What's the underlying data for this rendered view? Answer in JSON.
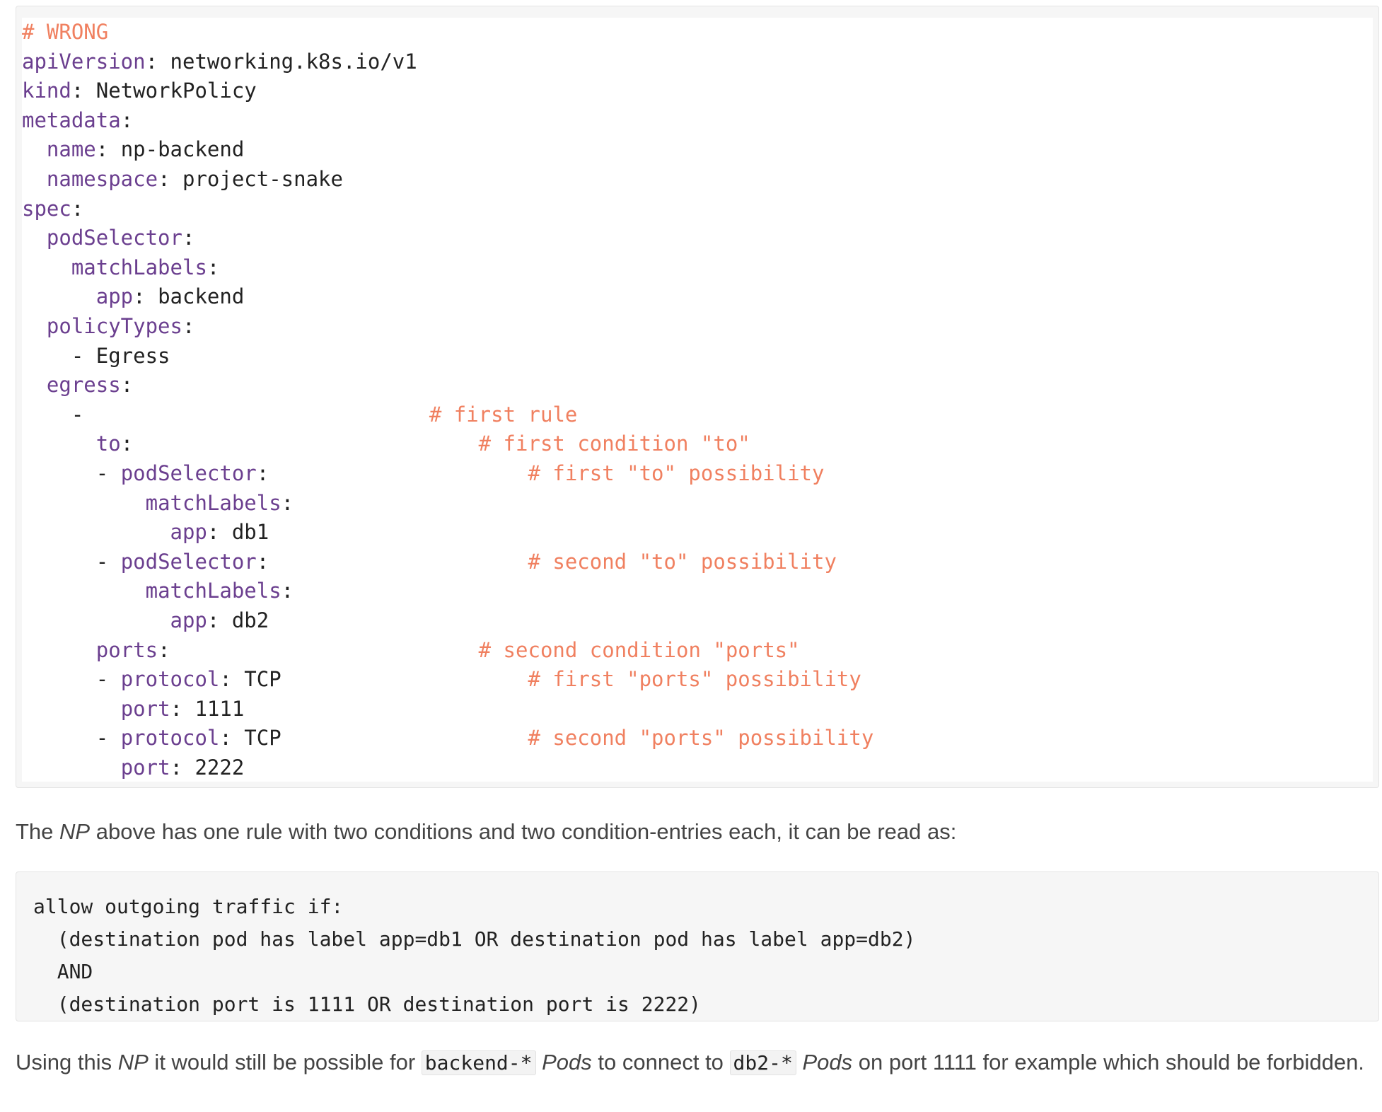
{
  "yaml_block": {
    "lines": [
      {
        "indent": "",
        "key": "",
        "value": "",
        "comment": "# WRONG",
        "comment_col": 0
      },
      {
        "indent": "",
        "key": "apiVersion",
        "value": "networking.k8s.io/v1",
        "comment": ""
      },
      {
        "indent": "",
        "key": "kind",
        "value": "NetworkPolicy",
        "comment": ""
      },
      {
        "indent": "",
        "key": "metadata",
        "value": "",
        "comment": ""
      },
      {
        "indent": "  ",
        "key": "name",
        "value": "np-backend",
        "comment": ""
      },
      {
        "indent": "  ",
        "key": "namespace",
        "value": "project-snake",
        "comment": ""
      },
      {
        "indent": "",
        "key": "spec",
        "value": "",
        "comment": ""
      },
      {
        "indent": "  ",
        "key": "podSelector",
        "value": "",
        "comment": ""
      },
      {
        "indent": "    ",
        "key": "matchLabels",
        "value": "",
        "comment": ""
      },
      {
        "indent": "      ",
        "key": "app",
        "value": "backend",
        "comment": ""
      },
      {
        "indent": "  ",
        "key": "policyTypes",
        "value": "",
        "comment": ""
      },
      {
        "indent": "    ",
        "key": "",
        "value": "- Egress",
        "comment": ""
      },
      {
        "indent": "  ",
        "key": "egress",
        "value": "",
        "comment": ""
      },
      {
        "indent": "    ",
        "key": "",
        "value": "-",
        "comment": "# first rule",
        "comment_col": 33
      },
      {
        "indent": "      ",
        "key": "to",
        "value": "",
        "comment": "# first condition \"to\"",
        "comment_col": 37
      },
      {
        "indent": "      - ",
        "key": "podSelector",
        "value": "",
        "comment": "# first \"to\" possibility",
        "comment_col": 41
      },
      {
        "indent": "          ",
        "key": "matchLabels",
        "value": "",
        "comment": ""
      },
      {
        "indent": "            ",
        "key": "app",
        "value": "db1",
        "comment": ""
      },
      {
        "indent": "      - ",
        "key": "podSelector",
        "value": "",
        "comment": "# second \"to\" possibility",
        "comment_col": 41
      },
      {
        "indent": "          ",
        "key": "matchLabels",
        "value": "",
        "comment": ""
      },
      {
        "indent": "            ",
        "key": "app",
        "value": "db2",
        "comment": ""
      },
      {
        "indent": "      ",
        "key": "ports",
        "value": "",
        "comment": "# second condition \"ports\"",
        "comment_col": 37
      },
      {
        "indent": "      - ",
        "key": "protocol",
        "value": "TCP",
        "comment": "# first \"ports\" possibility",
        "comment_col": 41
      },
      {
        "indent": "        ",
        "key": "port",
        "value": "1111",
        "comment": ""
      },
      {
        "indent": "      - ",
        "key": "protocol",
        "value": "TCP",
        "comment": "# second \"ports\" possibility",
        "comment_col": 41
      },
      {
        "indent": "        ",
        "key": "port",
        "value": "2222",
        "comment": ""
      }
    ]
  },
  "paragraph1": {
    "before": "The ",
    "em": "NP",
    "after": " above has one rule with two conditions and two condition-entries each, it can be read as:"
  },
  "pre_block": {
    "lines": [
      "allow outgoing traffic if:",
      "  (destination pod has label app=db1 OR destination pod has label app=db2)",
      "  AND",
      "  (destination port is 1111 OR destination port is 2222)"
    ]
  },
  "paragraph2": {
    "t1": "Using this ",
    "em1": "NP",
    "t2": " it would still be possible for ",
    "code1": "backend-*",
    "t3": " ",
    "em2": "Pods",
    "t4": " to connect to ",
    "code2": "db2-*",
    "t5": " ",
    "em3": "Pods",
    "t6": " on port 1111 for example which should be forbidden."
  },
  "colors": {
    "key": "#6b3f8f",
    "comment": "#f08060",
    "text": "#222222",
    "prose": "#444444"
  }
}
